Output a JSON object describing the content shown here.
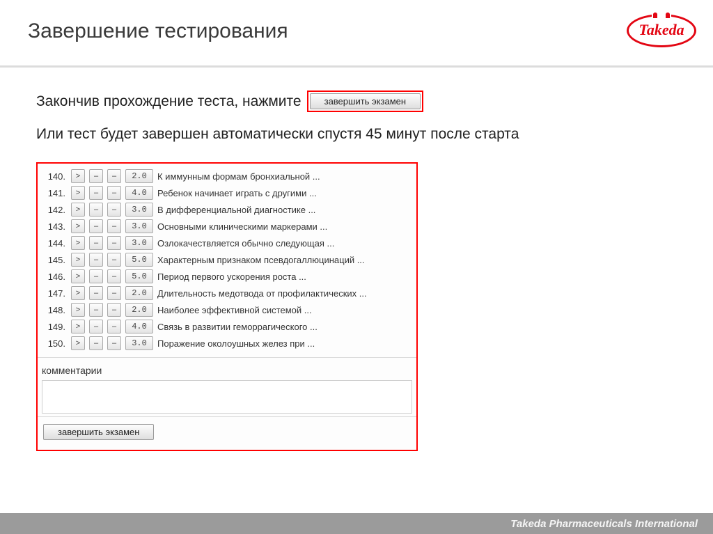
{
  "header": {
    "title": "Завершение тестирования",
    "logo_text": "Takeda"
  },
  "instructions": {
    "line1_prefix": "Закончив прохождение теста, нажмите",
    "finish_button_label": "завершить экзамен",
    "line2": "Или тест будет завершен автоматически спустя 45 минут после старта"
  },
  "panel": {
    "nav_symbol": ">",
    "minus_symbol": "–",
    "questions": [
      {
        "num": "140.",
        "score": "2.0",
        "text": "К иммунным формам бронхиальной ..."
      },
      {
        "num": "141.",
        "score": "4.0",
        "text": "Ребенок начинает играть с другими ..."
      },
      {
        "num": "142.",
        "score": "3.0",
        "text": "В дифференциальной диагностике ..."
      },
      {
        "num": "143.",
        "score": "3.0",
        "text": "Основными клиническими маркерами ..."
      },
      {
        "num": "144.",
        "score": "3.0",
        "text": "Озлокачествляется обычно следующая ..."
      },
      {
        "num": "145.",
        "score": "5.0",
        "text": "Характерным признаком псевдогаллюцинаций ..."
      },
      {
        "num": "146.",
        "score": "5.0",
        "text": "Период первого ускорения роста ..."
      },
      {
        "num": "147.",
        "score": "2.0",
        "text": "Длительность медотвода от профилактических ..."
      },
      {
        "num": "148.",
        "score": "2.0",
        "text": "Наиболее эффективной системой ..."
      },
      {
        "num": "149.",
        "score": "4.0",
        "text": "Связь в развитии геморрагического ..."
      },
      {
        "num": "150.",
        "score": "3.0",
        "text": "Поражение околоушных желез при ..."
      }
    ],
    "comments_label": "комментарии",
    "footer_button_label": "завершить экзамен"
  },
  "footer": {
    "company": "Takeda Pharmaceuticals International"
  }
}
